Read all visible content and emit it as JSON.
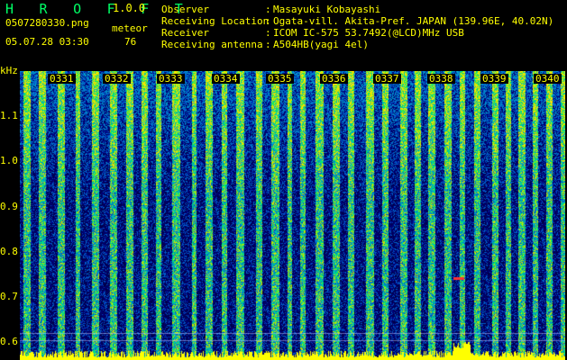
{
  "header": {
    "logo": "H R O F F T",
    "version": "1.0.0",
    "file_name": "0507280330.png",
    "datetime": "05.07.28 03:30",
    "meteor_label": "meteor",
    "meteor_count": "76"
  },
  "info": [
    {
      "label": "Observer",
      "sep": ":",
      "value": "Masayuki Kobayashi"
    },
    {
      "label": "Receiving Location",
      "sep": ":",
      "value": "Ogata-vill. Akita-Pref. JAPAN (139.96E, 40.02N)"
    },
    {
      "label": "Receiver",
      "sep": ":",
      "value": "ICOM IC-575 53.7492(@LCD)MHz USB"
    },
    {
      "label": "Receiving antenna",
      "sep": ":",
      "value": "A504HB(yagi 4el)"
    }
  ],
  "axis": {
    "unit": "kHz",
    "y_ticks": [
      "1.1",
      "1.0",
      "0.9",
      "0.8",
      "0.7",
      "0.6"
    ],
    "x_ticks": [
      "0331",
      "0332",
      "0333",
      "0334",
      "0335",
      "0336",
      "0337",
      "0338",
      "0339",
      "0340"
    ]
  },
  "colors": {
    "text": "#ffff00",
    "logo": "#00ff66",
    "background": "#000000",
    "waterfall_low": "#000044",
    "waterfall_mid": "#0066ff",
    "waterfall_high": "#00ff66",
    "waterfall_peak": "#ffff00",
    "marker_red": "#ff3333"
  }
}
